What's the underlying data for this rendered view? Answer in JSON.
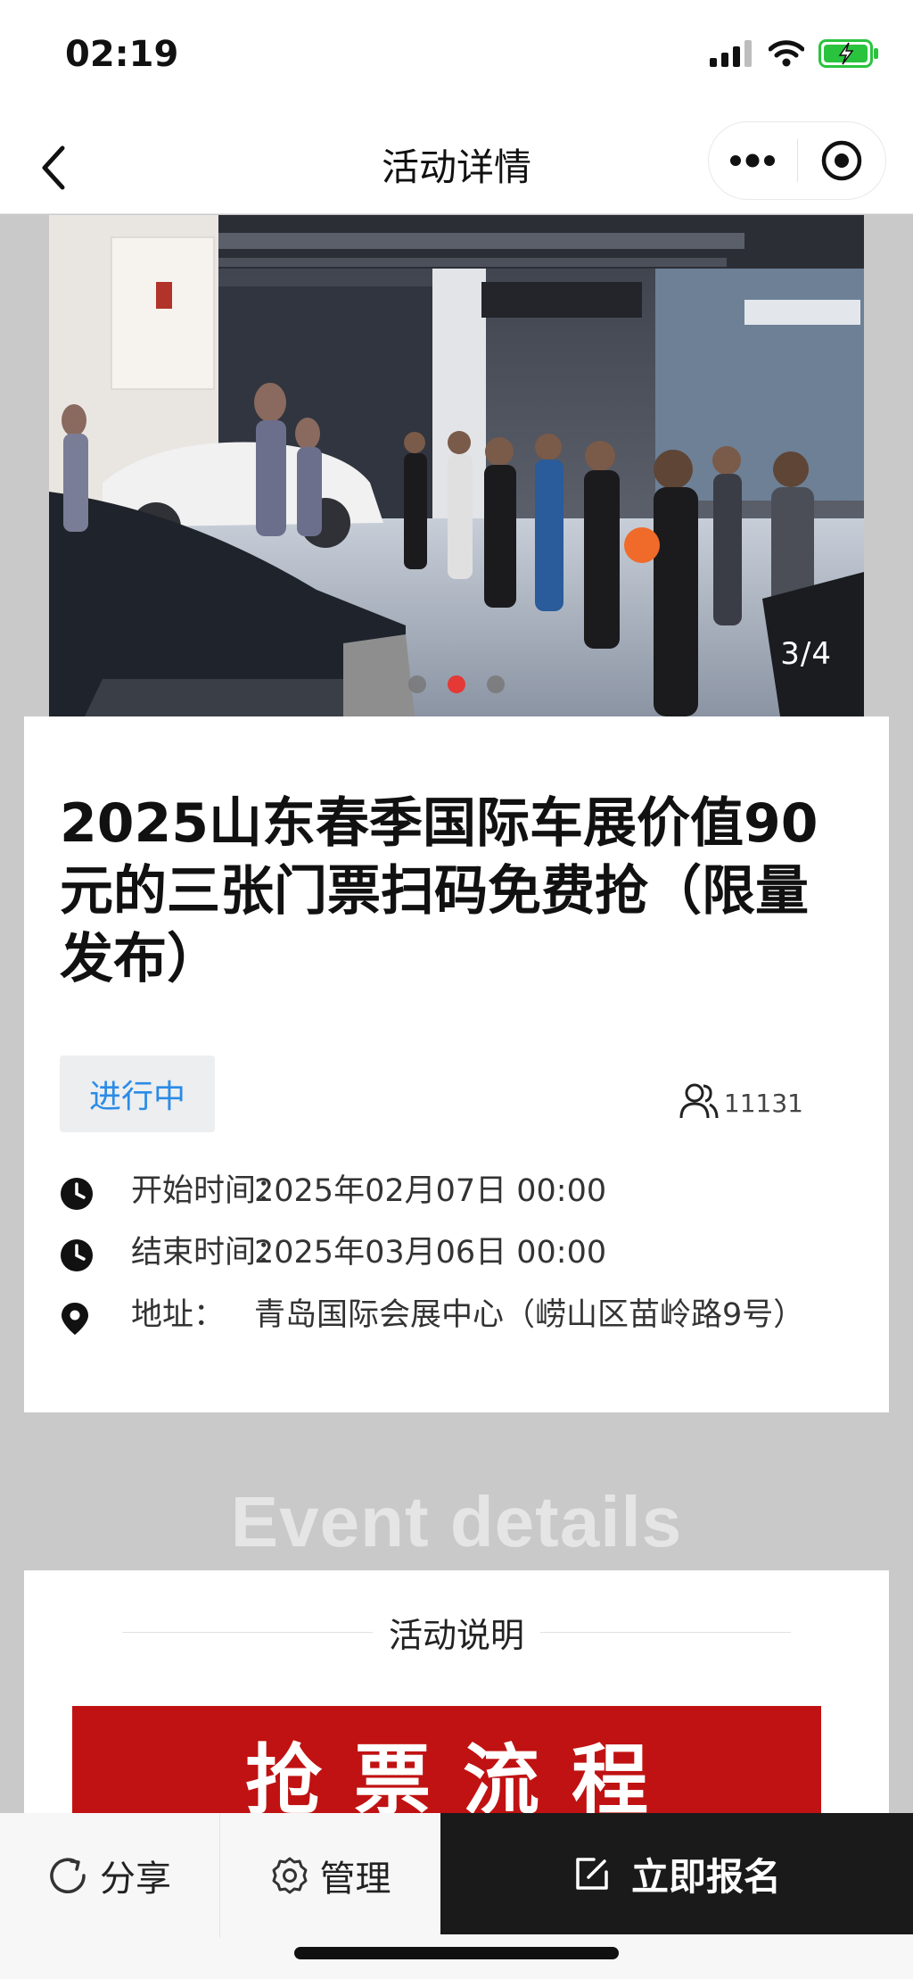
{
  "status_bar": {
    "time": "02:19"
  },
  "navbar": {
    "title": "活动详情"
  },
  "banner": {
    "counter": "3/4",
    "slide_count": 3,
    "active_index": 1
  },
  "event": {
    "title": "2025山东春季国际车展价值90元的三张门票扫码免费抢（限量发布）",
    "status": "进行中",
    "participants": "11131",
    "start_label": "开始时间：",
    "start_value": "2025年02月07日 00:00",
    "end_label": "结束时间：",
    "end_value": "2025年03月06日 00:00",
    "address_label": "地址：",
    "address_value": "青岛国际会展中心（崂山区苗岭路9号）"
  },
  "section": {
    "heading": "Event details"
  },
  "description": {
    "title": "活动说明",
    "banner_text": "抢票流程"
  },
  "bottom_bar": {
    "share": "分享",
    "manage": "管理",
    "register": "立即报名"
  },
  "colors": {
    "accent_blue": "#2b8be6",
    "active_dot": "#e53935",
    "flow_red": "#c01212",
    "cta_black": "#1a1a1a"
  }
}
